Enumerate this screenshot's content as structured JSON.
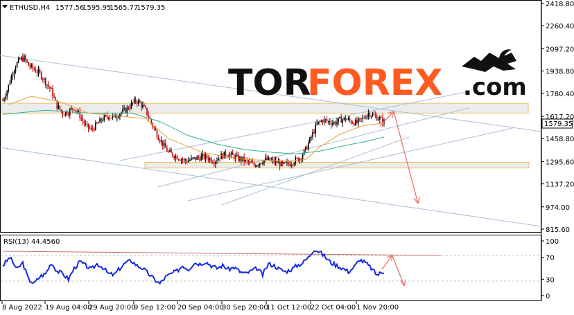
{
  "header": {
    "symbol": "ETHUSD,H4",
    "open": "1577.56",
    "high": "1595.95",
    "low": "1565.77",
    "close": "1579.35"
  },
  "current_price": "1579.35",
  "watermark": {
    "tor": "TOR",
    "forex": "FOREX",
    "com": ".com"
  },
  "rsi": {
    "label": "RSI(13) 44.4560"
  },
  "colors": {
    "bull": "#000000",
    "bear": "#c00000",
    "ma_fast": "#e8a030",
    "ma_slow": "#2ab09a",
    "rsi": "#1428e0",
    "arrow": "#f0706a",
    "channel": "#a9bfd6",
    "zone_fill": "#ececec",
    "zone_border": "#e8c26a",
    "logo_orange": "#ff5a1f"
  },
  "chart_data": [
    {
      "type": "candlestick",
      "title": "ETHUSD,H4",
      "y_ticks": [
        2418.8,
        2260.4,
        2097.2,
        1938.8,
        1780.4,
        1617.2,
        1458.8,
        1295.6,
        1137.2,
        974.0,
        815.6
      ],
      "y_tick_labels": [
        "2418.80",
        "2260.40",
        "2097.20",
        "1938.80",
        "1780.40",
        "1617.20",
        "1458.80",
        "1295.60",
        "1137.20",
        "974.00",
        "815.60"
      ],
      "ylim": [
        765,
        2470
      ],
      "x_tick_labels": [
        "8 Aug 2022",
        "19 Aug 04:00",
        "29 Aug 20:00",
        "9 Sep 12:00",
        "20 Sep 04:00",
        "30 Sep 20:00",
        "11 Oct 12:00",
        "22 Oct 04:00",
        "1 Nov 20:00"
      ],
      "price_path": [
        [
          0,
          1730
        ],
        [
          3,
          1800
        ],
        [
          6,
          1900
        ],
        [
          9,
          1980
        ],
        [
          12,
          2020
        ],
        [
          15,
          2030
        ],
        [
          18,
          1980
        ],
        [
          22,
          1950
        ],
        [
          26,
          1920
        ],
        [
          30,
          1860
        ],
        [
          34,
          1800
        ],
        [
          38,
          1690
        ],
        [
          42,
          1640
        ],
        [
          46,
          1650
        ],
        [
          50,
          1680
        ],
        [
          54,
          1620
        ],
        [
          58,
          1550
        ],
        [
          62,
          1520
        ],
        [
          66,
          1560
        ],
        [
          70,
          1600
        ],
        [
          74,
          1620
        ],
        [
          78,
          1610
        ],
        [
          82,
          1640
        ],
        [
          86,
          1660
        ],
        [
          90,
          1700
        ],
        [
          93,
          1730
        ],
        [
          96,
          1710
        ],
        [
          100,
          1660
        ],
        [
          104,
          1570
        ],
        [
          108,
          1490
        ],
        [
          112,
          1420
        ],
        [
          116,
          1360
        ],
        [
          120,
          1340
        ],
        [
          124,
          1320
        ],
        [
          128,
          1300
        ],
        [
          132,
          1310
        ],
        [
          136,
          1320
        ],
        [
          140,
          1330
        ],
        [
          144,
          1320
        ],
        [
          148,
          1300
        ],
        [
          152,
          1330
        ],
        [
          156,
          1350
        ],
        [
          160,
          1340
        ],
        [
          164,
          1320
        ],
        [
          168,
          1310
        ],
        [
          172,
          1290
        ],
        [
          176,
          1270
        ],
        [
          180,
          1290
        ],
        [
          184,
          1310
        ],
        [
          188,
          1300
        ],
        [
          192,
          1290
        ],
        [
          196,
          1270
        ],
        [
          200,
          1280
        ],
        [
          204,
          1300
        ],
        [
          208,
          1320
        ],
        [
          212,
          1380
        ],
        [
          216,
          1470
        ],
        [
          220,
          1560
        ],
        [
          224,
          1590
        ],
        [
          228,
          1580
        ],
        [
          232,
          1570
        ],
        [
          236,
          1590
        ],
        [
          240,
          1600
        ],
        [
          244,
          1580
        ],
        [
          248,
          1570
        ],
        [
          252,
          1600
        ],
        [
          256,
          1640
        ],
        [
          260,
          1620
        ],
        [
          264,
          1600
        ],
        [
          267,
          1579
        ]
      ],
      "ma_fast": [
        [
          4,
          1700
        ],
        [
          20,
          1760
        ],
        [
          40,
          1720
        ],
        [
          60,
          1640
        ],
        [
          80,
          1620
        ],
        [
          100,
          1600
        ],
        [
          116,
          1460
        ],
        [
          140,
          1360
        ],
        [
          170,
          1310
        ],
        [
          200,
          1300
        ],
        [
          212,
          1310
        ],
        [
          222,
          1400
        ],
        [
          236,
          1490
        ],
        [
          252,
          1550
        ],
        [
          267,
          1570
        ]
      ],
      "ma_slow": [
        [
          0,
          1630
        ],
        [
          30,
          1660
        ],
        [
          60,
          1640
        ],
        [
          90,
          1640
        ],
        [
          110,
          1580
        ],
        [
          130,
          1480
        ],
        [
          150,
          1420
        ],
        [
          170,
          1380
        ],
        [
          190,
          1360
        ],
        [
          205,
          1350
        ],
        [
          222,
          1370
        ],
        [
          240,
          1410
        ],
        [
          255,
          1440
        ],
        [
          267,
          1470
        ]
      ],
      "support_zone": [
        1250,
        1290
      ],
      "resistance_zone": [
        1640,
        1710
      ]
    },
    {
      "type": "line",
      "title": "RSI(13) 44.4560",
      "y_ticks": [
        100,
        70,
        30,
        0
      ],
      "y_tick_labels": [
        "100",
        "70",
        "30",
        "0"
      ],
      "ylim": [
        -5,
        105
      ],
      "rsi_path": [
        [
          0,
          55
        ],
        [
          5,
          70
        ],
        [
          10,
          48
        ],
        [
          14,
          60
        ],
        [
          18,
          30
        ],
        [
          22,
          22
        ],
        [
          26,
          35
        ],
        [
          30,
          40
        ],
        [
          34,
          60
        ],
        [
          38,
          45
        ],
        [
          42,
          40
        ],
        [
          46,
          30
        ],
        [
          50,
          50
        ],
        [
          54,
          62
        ],
        [
          58,
          55
        ],
        [
          62,
          48
        ],
        [
          66,
          58
        ],
        [
          70,
          52
        ],
        [
          74,
          40
        ],
        [
          78,
          38
        ],
        [
          82,
          50
        ],
        [
          86,
          60
        ],
        [
          90,
          64
        ],
        [
          94,
          55
        ],
        [
          98,
          50
        ],
        [
          102,
          40
        ],
        [
          106,
          30
        ],
        [
          110,
          22
        ],
        [
          114,
          34
        ],
        [
          118,
          40
        ],
        [
          122,
          45
        ],
        [
          126,
          55
        ],
        [
          130,
          48
        ],
        [
          134,
          60
        ],
        [
          138,
          58
        ],
        [
          142,
          62
        ],
        [
          146,
          55
        ],
        [
          150,
          50
        ],
        [
          154,
          55
        ],
        [
          158,
          48
        ],
        [
          162,
          52
        ],
        [
          166,
          44
        ],
        [
          170,
          40
        ],
        [
          174,
          45
        ],
        [
          178,
          50
        ],
        [
          182,
          38
        ],
        [
          186,
          58
        ],
        [
          190,
          55
        ],
        [
          194,
          48
        ],
        [
          198,
          44
        ],
        [
          202,
          48
        ],
        [
          206,
          55
        ],
        [
          210,
          60
        ],
        [
          214,
          70
        ],
        [
          218,
          85
        ],
        [
          222,
          80
        ],
        [
          226,
          70
        ],
        [
          230,
          60
        ],
        [
          234,
          55
        ],
        [
          238,
          50
        ],
        [
          242,
          44
        ],
        [
          246,
          52
        ],
        [
          250,
          66
        ],
        [
          254,
          60
        ],
        [
          258,
          50
        ],
        [
          262,
          38
        ],
        [
          267,
          44
        ]
      ]
    }
  ]
}
